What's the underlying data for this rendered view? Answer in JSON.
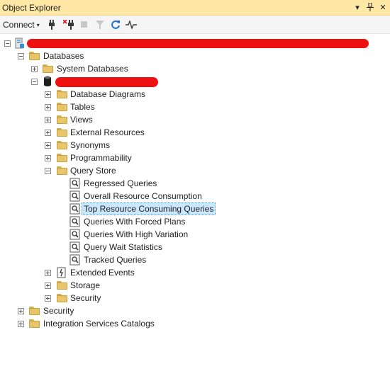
{
  "window": {
    "title": "Object Explorer",
    "buttons": {
      "dropdown": "▾",
      "pin": "⊥",
      "close": "✕"
    }
  },
  "toolbar": {
    "connect_label": "Connect",
    "connect_caret": "▾"
  },
  "tree": {
    "databases": "Databases",
    "system_databases": "System Databases",
    "db_children": [
      "Database Diagrams",
      "Tables",
      "Views",
      "External Resources",
      "Synonyms",
      "Programmability",
      "Query Store"
    ],
    "query_store_children": [
      "Regressed Queries",
      "Overall Resource Consumption",
      "Top Resource Consuming Queries",
      "Queries With Forced Plans",
      "Queries With High Variation",
      "Query Wait Statistics",
      "Tracked Queries"
    ],
    "db_children_after": [
      "Extended Events",
      "Storage",
      "Security"
    ],
    "server_children_after": [
      "Security",
      "Integration Services Catalogs"
    ],
    "selected_item": "Top Resource Consuming Queries"
  },
  "colors": {
    "title_bar": "#ffe8a6",
    "selection_bg": "#cce8ff",
    "redaction": "#ee1111",
    "folder": "#e8c46a"
  }
}
